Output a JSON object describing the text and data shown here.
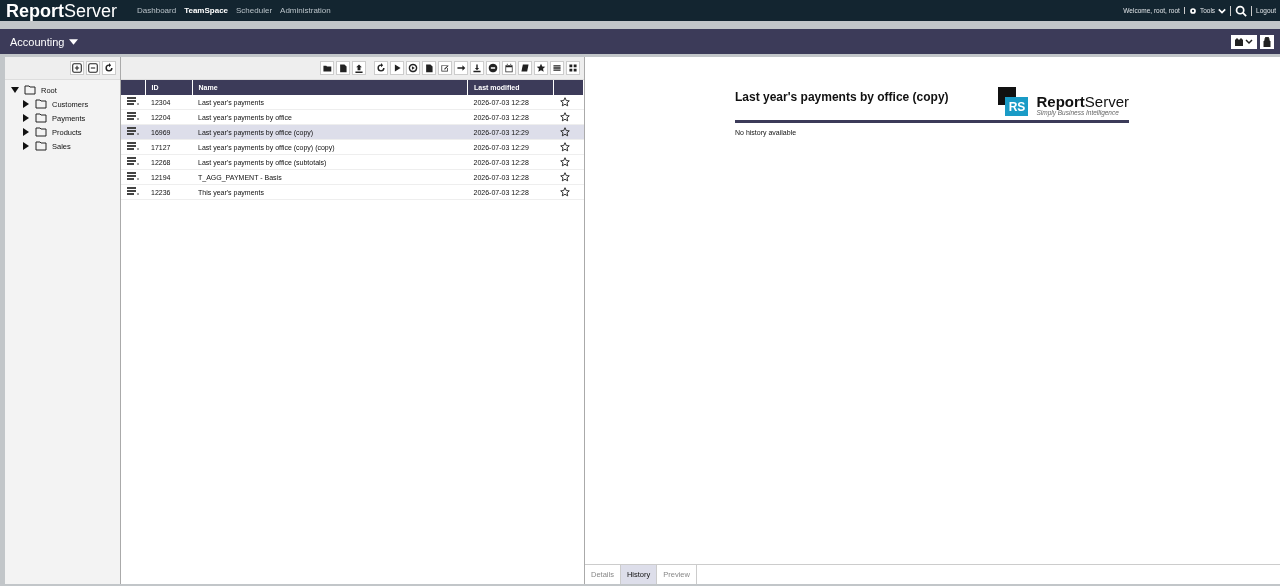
{
  "header": {
    "logo": "**Report**Server",
    "nav": [
      {
        "label": "Dashboard",
        "selected": false
      },
      {
        "label": "TeamSpace",
        "selected": true
      },
      {
        "label": "Scheduler",
        "selected": false
      },
      {
        "label": "Administration",
        "selected": false
      }
    ],
    "welcome": "Welcome, root, root",
    "tools": "Tools",
    "logout": "Logout"
  },
  "teamspace": {
    "title": "Accounting"
  },
  "tree": [
    {
      "label": "Root",
      "expanded": true,
      "children": [
        {
          "label": "Customers",
          "expanded": false
        },
        {
          "label": "Payments",
          "expanded": false
        },
        {
          "label": "Products",
          "expanded": false
        },
        {
          "label": "Sales",
          "expanded": false
        }
      ]
    }
  ],
  "table": {
    "columns": [
      "ID",
      "Name",
      "Last modified"
    ],
    "rows": [
      {
        "id": "12304",
        "name": "Last year's payments",
        "modified": "2026-07-03 12:28",
        "selected": false
      },
      {
        "id": "12204",
        "name": "Last year's payments by office",
        "modified": "2026-07-03 12:28",
        "selected": false
      },
      {
        "id": "16969",
        "name": "Last year's payments by office (copy)",
        "modified": "2026-07-03 12:29",
        "selected": true
      },
      {
        "id": "17127",
        "name": "Last year's payments by office (copy) (copy)",
        "modified": "2026-07-03 12:29",
        "selected": false
      },
      {
        "id": "12268",
        "name": "Last year's payments by office (subtotals)",
        "modified": "2026-07-03 12:28",
        "selected": false
      },
      {
        "id": "12194",
        "name": "T_AGG_PAYMENT - Basis",
        "modified": "2026-07-03 12:28",
        "selected": false
      },
      {
        "id": "12236",
        "name": "This year's payments",
        "modified": "2026-07-03 12:28",
        "selected": false
      }
    ]
  },
  "preview": {
    "title": "Last year's payments by office (copy)",
    "logo_badge": "RS",
    "logo_name": "**Report**Server",
    "logo_tagline": "Simply Business Intelligence",
    "message": "No history available"
  },
  "tabs": [
    {
      "label": "Details",
      "selected": false
    },
    {
      "label": "History",
      "selected": true
    },
    {
      "label": "Preview",
      "selected": false
    }
  ]
}
